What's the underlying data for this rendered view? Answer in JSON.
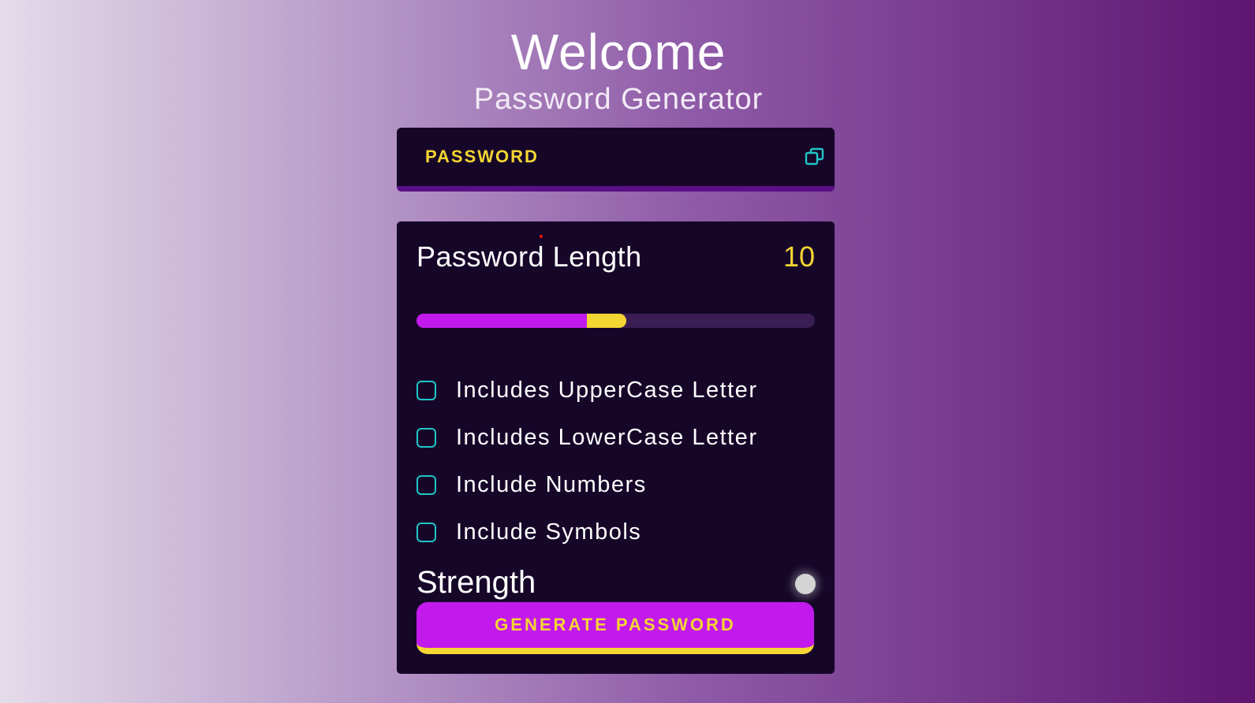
{
  "header": {
    "title": "Welcome",
    "subtitle": "Password Generator"
  },
  "display": {
    "placeholder": "PASSWORD",
    "copy_icon": "copy-icon"
  },
  "length": {
    "label": "Password Length",
    "value": "10",
    "slider_fill_percent": 46
  },
  "options": [
    {
      "label": "Includes UpperCase Letter",
      "checked": false
    },
    {
      "label": "Includes LowerCase Letter",
      "checked": false
    },
    {
      "label": "Include Numbers",
      "checked": false
    },
    {
      "label": "Include Symbols",
      "checked": false
    }
  ],
  "strength": {
    "label": "Strength",
    "indicator_color": "#d4d4d4"
  },
  "generate": {
    "label": "GENERATE PASSWORD"
  },
  "colors": {
    "accent_yellow": "#f4d632",
    "accent_purple": "#c21aed",
    "panel_bg": "#160729",
    "checkbox_border": "#1fc6c6"
  }
}
